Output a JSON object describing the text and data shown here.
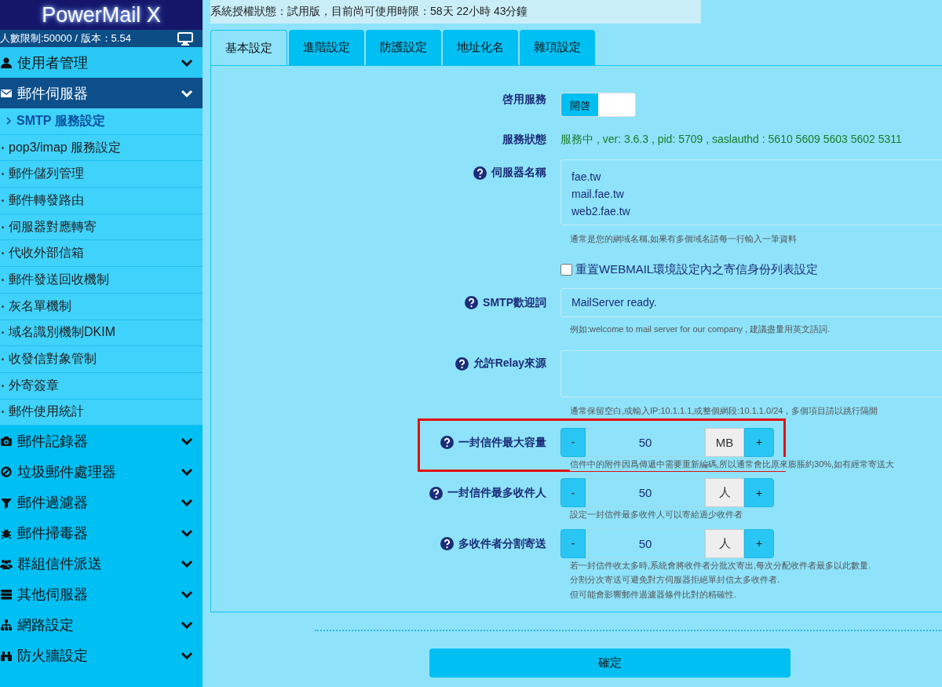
{
  "sidebar": {
    "logo": "PowerMail X",
    "info": "人數限制:50000 / 版本：5.54",
    "groups": [
      {
        "label": "使用者管理",
        "expanded": false
      },
      {
        "label": "郵件伺服器",
        "expanded": true,
        "children": [
          {
            "label": "SMTP 服務設定",
            "selected": true
          },
          {
            "label": "pop3/imap 服務設定",
            "selected": false
          },
          {
            "label": "郵件儲列管理",
            "selected": false
          },
          {
            "label": "郵件轉發路由",
            "selected": false
          },
          {
            "label": "伺服器對應轉寄",
            "selected": false
          },
          {
            "label": "代收外部信箱",
            "selected": false
          },
          {
            "label": "郵件發送回收機制",
            "selected": false
          },
          {
            "label": "灰名單機制",
            "selected": false
          },
          {
            "label": "域名識別機制DKIM",
            "selected": false
          },
          {
            "label": "收發信對象管制",
            "selected": false
          },
          {
            "label": "外寄簽章",
            "selected": false
          },
          {
            "label": "郵件使用統計",
            "selected": false
          }
        ]
      },
      {
        "label": "郵件記錄器",
        "expanded": false
      },
      {
        "label": "垃圾郵件處理器",
        "expanded": false
      },
      {
        "label": "郵件過濾器",
        "expanded": false
      },
      {
        "label": "郵件掃毒器",
        "expanded": false
      },
      {
        "label": "群組信件派送",
        "expanded": false
      },
      {
        "label": "其他伺服器",
        "expanded": false
      },
      {
        "label": "網路設定",
        "expanded": false
      },
      {
        "label": "防火牆設定",
        "expanded": false
      }
    ]
  },
  "license": "系統授權狀態：試用版，目前尚可使用時限：58天 22小時 43分鐘",
  "tabs": [
    {
      "label": "基本設定",
      "selected": true
    },
    {
      "label": "進階設定",
      "selected": false
    },
    {
      "label": "防護設定",
      "selected": false
    },
    {
      "label": "地址化名",
      "selected": false
    },
    {
      "label": "雜項設定",
      "selected": false
    }
  ],
  "form": [
    {
      "kind": "toggle",
      "label": "啓用服務",
      "on": true,
      "text": "開啓"
    },
    {
      "kind": "status",
      "label": "服務狀態",
      "value": "服務中 , ver: 3.6.3 , pid: 5709 , saslauthd : 5610 5609 5603 5602 5311"
    },
    {
      "kind": "textarea",
      "label": "伺服器名稱",
      "lines": [
        "fae.tw",
        "mail.fae.tw",
        "web2.fae.tw"
      ],
      "hint": [
        "通常是您的網域名稱,如果有多個域名請每一行輸入一筆資料"
      ]
    },
    {
      "kind": "checkbox",
      "label": "重置WEBMAIL環境設定內之寄信身份列表設定",
      "checked": false
    },
    {
      "kind": "text",
      "label": "SMTP歡迎詞",
      "value": "MailServer ready.",
      "hint": [
        "例如:welcome to mail server for our company , 建議盡量用英文語詞."
      ]
    },
    {
      "kind": "textarea",
      "label": "允許Relay來源",
      "hint": [
        "通常保留空白,或輸入IP:10.1.1.1,或整個網段:10.1.1.0/24，多個項目請以跳行隔開"
      ]
    },
    {
      "kind": "number",
      "label": "一封信件最大容量",
      "minus": "-",
      "value": "50",
      "unit": "MB",
      "plus": "+",
      "highlighted": true,
      "hint": [
        "信件中的附件因爲傳遞中需要重新編碼,所以通常會比原來膨脹約30%,如有經常寄送大"
      ]
    },
    {
      "kind": "number",
      "label": "一封信件最多收件人",
      "minus": "-",
      "value": "50",
      "unit": "人",
      "plus": "+",
      "highlighted": false,
      "hint": [
        "設定一封信件最多收件人可以寄給過少收件者"
      ]
    },
    {
      "kind": "number",
      "label": "多收件者分割寄送",
      "minus": "-",
      "value": "50",
      "unit": "人",
      "plus": "+",
      "highlighted": false,
      "hint": [
        "若一封信件收太多時,系統會將收件者分批次寄出,每次分配收件者最多以此數量.",
        "分割分次寄送可避免對方伺服器拒絕單封信太多收件者.",
        "但可能會影響郵件過濾器條件比對的精確性."
      ]
    }
  ],
  "submit": "確定"
}
